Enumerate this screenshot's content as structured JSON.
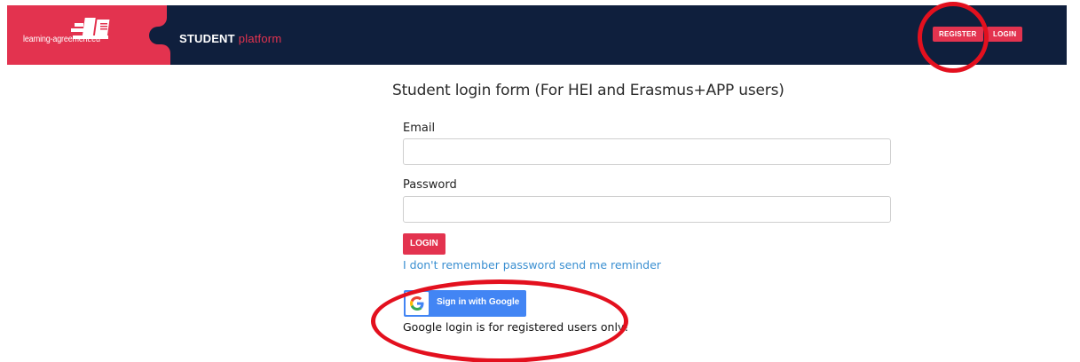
{
  "header": {
    "logo_text": "learning-agreement.eu",
    "brand_main": "STUDENT",
    "brand_accent": "platform",
    "nav": {
      "register_label": "REGISTER",
      "login_label": "LOGIN"
    }
  },
  "form": {
    "title": "Student login form (For HEI and Erasmus+APP users)",
    "email_label": "Email",
    "email_value": "",
    "password_label": "Password",
    "password_value": "",
    "login_button": "LOGIN",
    "reminder_link": "I don't remember password send me reminder"
  },
  "google": {
    "button_label": "Sign in with Google",
    "icon": "google-g-icon",
    "note": "Google login is for registered users only!"
  },
  "colors": {
    "navy": "#0f1f3d",
    "accent": "#e3334f",
    "google_blue": "#4285f4",
    "link": "#3a8fd1",
    "annotation_red": "#e3101e"
  }
}
